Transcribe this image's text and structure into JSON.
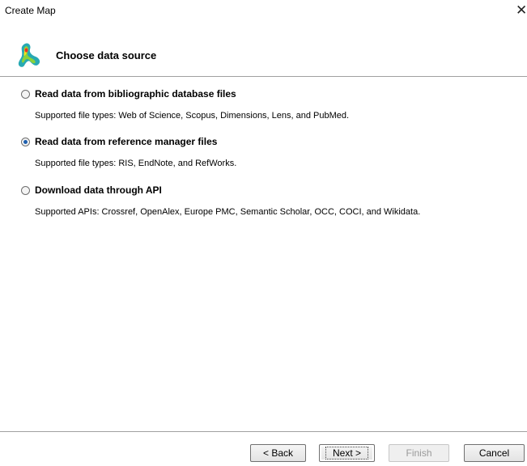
{
  "window": {
    "title": "Create Map",
    "close_glyph": "✕"
  },
  "header": {
    "title": "Choose data source",
    "logo_icon": "vosviewer-logo-icon"
  },
  "options": [
    {
      "label": "Read data from bibliographic database files",
      "description": "Supported file types: Web of Science, Scopus, Dimensions, Lens, and PubMed.",
      "selected": false
    },
    {
      "label": "Read data from reference manager files",
      "description": "Supported file types: RIS, EndNote, and RefWorks.",
      "selected": true
    },
    {
      "label": "Download data through API",
      "description": "Supported APIs: Crossref, OpenAlex, Europe PMC, Semantic Scholar, OCC, COCI, and Wikidata.",
      "selected": false
    }
  ],
  "buttons": {
    "back": "< Back",
    "next": "Next >",
    "finish": "Finish",
    "cancel": "Cancel"
  },
  "colors": {
    "radio_selected": "#1e5fae",
    "separator": "#a0a0a0"
  }
}
